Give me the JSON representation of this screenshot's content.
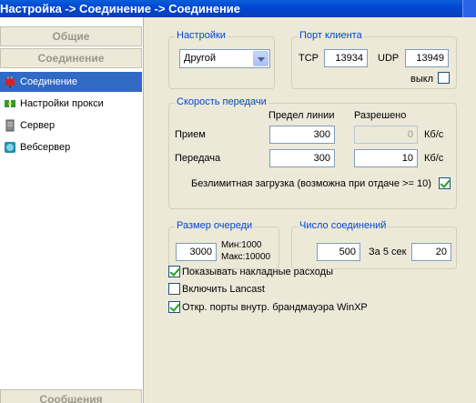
{
  "window": {
    "title": "Настройка -> Соединение -> Соединение"
  },
  "sidebar": {
    "group_general": "Общие",
    "group_connection": "Соединение",
    "items": [
      {
        "label": "Соединение",
        "icon": "plug-icon"
      },
      {
        "label": "Настройки прокси",
        "icon": "proxy-icon"
      },
      {
        "label": "Сервер",
        "icon": "server-icon"
      },
      {
        "label": "Вебсервер",
        "icon": "globe-icon"
      }
    ],
    "group_messages": "Сообщения"
  },
  "settings": {
    "legend": "Настройки",
    "preset_value": "Другой"
  },
  "client_port": {
    "legend": "Порт клиента",
    "tcp_label": "TCP",
    "tcp_value": "13934",
    "udp_label": "UDP",
    "udp_value": "13949",
    "off_label": "выкл",
    "off_checked": false
  },
  "speed": {
    "legend": "Скорость передачи",
    "col_line_limit": "Предел линии",
    "col_allowed": "Разрешено",
    "receive_label": "Прием",
    "receive_limit": "300",
    "receive_allowed": "0",
    "send_label": "Передача",
    "send_limit": "300",
    "send_allowed": "10",
    "unit_receive": "Кб/с",
    "unit_send": "Кб/с",
    "unlimited_label": "Безлимитная загрузка (возможна при отдаче >= 10)",
    "unlimited_checked": true
  },
  "queue": {
    "legend": "Размер очереди",
    "value": "3000",
    "min_text": "Мин:1000",
    "max_text": "Макс:10000"
  },
  "connections": {
    "legend": "Число соединений",
    "value": "500",
    "per_label": "За 5 сек",
    "per_value": "20"
  },
  "options": [
    {
      "label": "Показывать накладные расходы",
      "checked": true
    },
    {
      "label": "Включить Lancast",
      "checked": false
    },
    {
      "label": "Откр. порты внутр.  брандмауэра WinXP",
      "checked": true
    }
  ],
  "colors": {
    "title_bar": "#0046d5",
    "selection": "#316ac5",
    "legend_text": "#0046d5"
  }
}
